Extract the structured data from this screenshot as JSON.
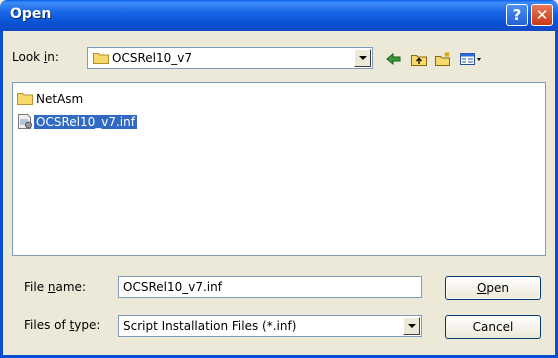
{
  "window": {
    "title": "Open",
    "help_glyph": "?",
    "close_glyph": "✕"
  },
  "lookin": {
    "label_prefix": "Look ",
    "label_accel": "i",
    "label_suffix": "n:",
    "value": "OCSRel10_v7"
  },
  "toolbar": {
    "icons": [
      "back-arrow-icon",
      "up-folder-icon",
      "new-folder-icon",
      "view-menu-icon"
    ]
  },
  "files": [
    {
      "name": "NetAsm",
      "type": "folder",
      "selected": false
    },
    {
      "name": "OCSRel10_v7.inf",
      "type": "inf-file",
      "selected": true
    }
  ],
  "filename": {
    "label_prefix": "File ",
    "label_accel": "n",
    "label_suffix": "ame:",
    "value": "OCSRel10_v7.inf"
  },
  "filetype": {
    "label_prefix": "Files of ",
    "label_accel": "t",
    "label_suffix": "ype:",
    "value": "Script Installation Files (*.inf)"
  },
  "buttons": {
    "open_accel": "O",
    "open_rest": "pen",
    "cancel": "Cancel"
  },
  "colors": {
    "titlebar": "#0a53d6",
    "selection": "#316ac5",
    "dialog_bg": "#ece9d8"
  }
}
